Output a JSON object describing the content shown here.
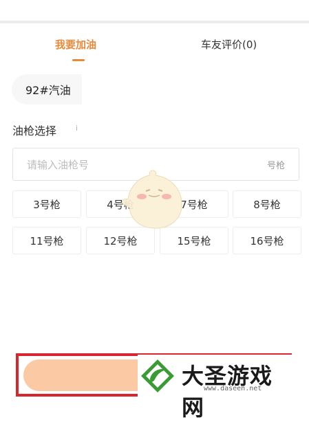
{
  "tabs": [
    {
      "label": "我要加油",
      "active": true
    },
    {
      "label": "车友评价(0)",
      "active": false
    }
  ],
  "fuel": {
    "selected": "92#汽油"
  },
  "nozzle": {
    "title": "油枪选择",
    "info_icon": "i",
    "input_placeholder": "请输入油枪号",
    "input_unit": "号枪",
    "options": [
      "3号枪",
      "4号枪",
      "7号枪",
      "8号枪",
      "11号枪",
      "12号枪",
      "15号枪",
      "16号枪"
    ]
  },
  "watermark": {
    "title": "大圣游戏网",
    "url": "www.daseen.net"
  },
  "colors": {
    "accent": "#e8893a",
    "confirm": "#fbcaa4",
    "frame": "#d8262f",
    "logo_green": "#3a9b35"
  }
}
